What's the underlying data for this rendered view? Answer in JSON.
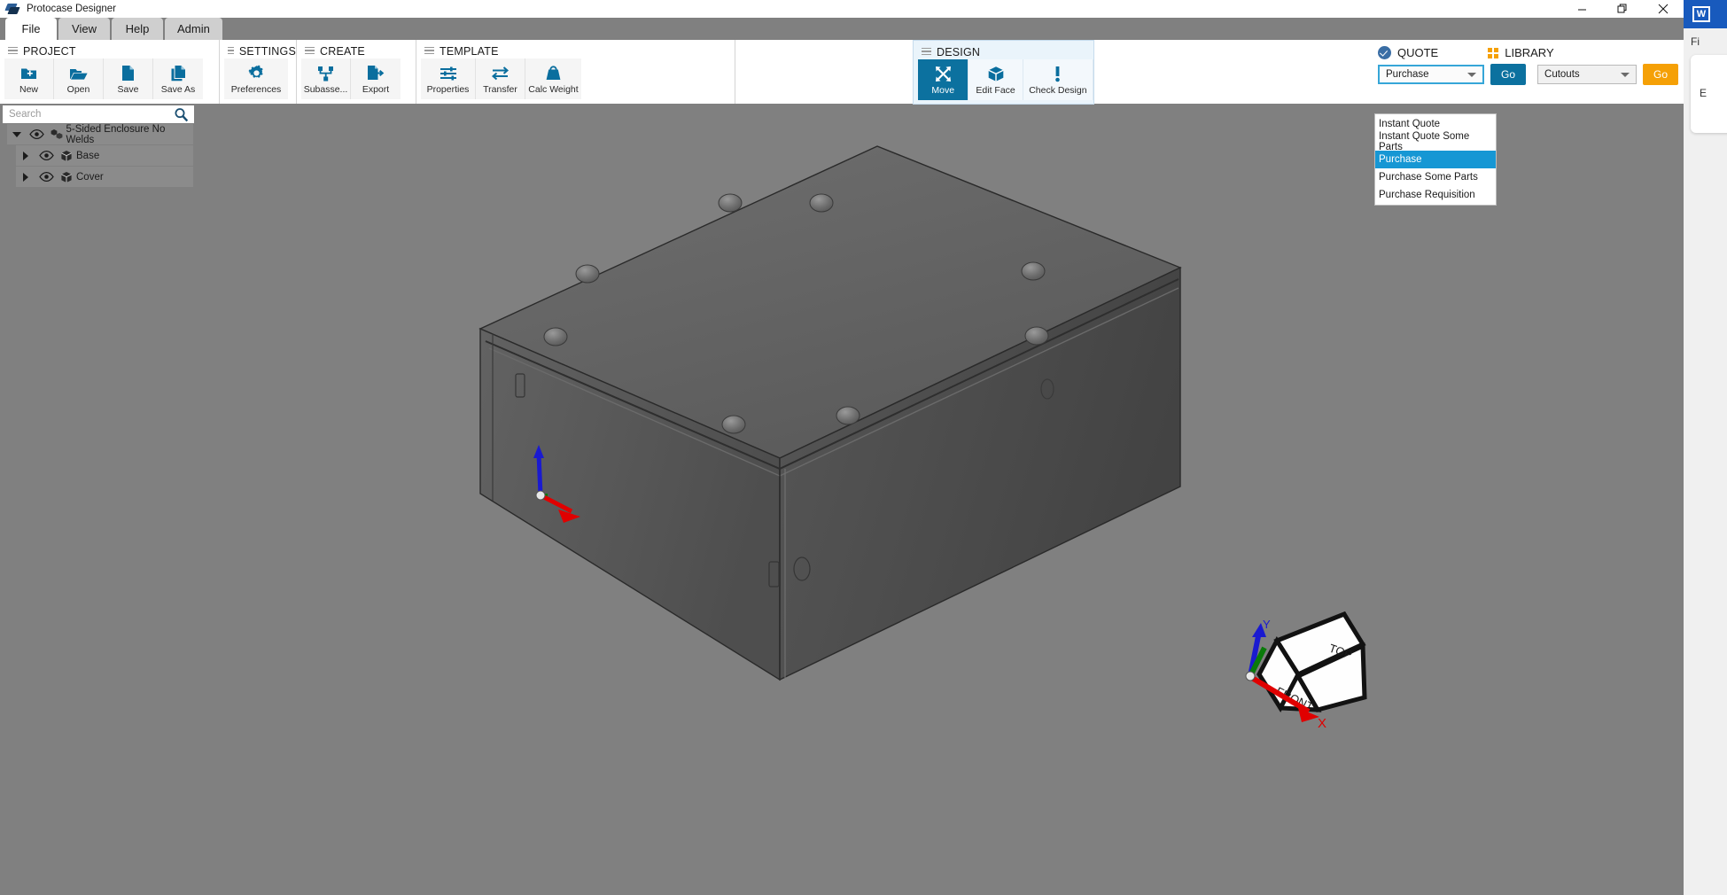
{
  "window": {
    "title": "Protocase Designer",
    "logo_icon": "protocase-logo-icon",
    "minimize_label": "Minimize",
    "restore_label": "Restore",
    "close_label": "Close"
  },
  "tabs": [
    {
      "label": "File",
      "active": true
    },
    {
      "label": "View",
      "active": false
    },
    {
      "label": "Help",
      "active": false
    },
    {
      "label": "Admin",
      "active": false
    }
  ],
  "ribbon": {
    "groups": [
      {
        "title": "PROJECT",
        "buttons": [
          {
            "label": "New",
            "icon": "new-folder-icon"
          },
          {
            "label": "Open",
            "icon": "open-folder-icon"
          },
          {
            "label": "Save",
            "icon": "file-icon"
          },
          {
            "label": "Save As",
            "icon": "copy-files-icon"
          }
        ]
      },
      {
        "title": "SETTINGS",
        "buttons": [
          {
            "label": "Preferences",
            "icon": "gear-icon"
          }
        ]
      },
      {
        "title": "CREATE",
        "buttons": [
          {
            "label": "Subasse...",
            "icon": "subassembly-icon"
          },
          {
            "label": "Export",
            "icon": "export-icon"
          }
        ]
      },
      {
        "title": "TEMPLATE",
        "buttons": [
          {
            "label": "Properties",
            "icon": "sliders-icon"
          },
          {
            "label": "Transfer",
            "icon": "transfer-arrows-icon"
          },
          {
            "label": "Calc Weight",
            "icon": "weight-icon"
          }
        ]
      },
      {
        "title": "DESIGN",
        "buttons": [
          {
            "label": "Move",
            "icon": "move-arrows-icon",
            "active": true
          },
          {
            "label": "Edit Face",
            "icon": "cube-icon"
          },
          {
            "label": "Check Design",
            "icon": "exclamation-icon"
          }
        ]
      }
    ]
  },
  "quote_panel": {
    "quote": {
      "heading": "QUOTE",
      "heading_icon": "check-circle-icon",
      "selected_value": "Purchase",
      "go_label": "Go",
      "options": [
        "Instant Quote",
        "Instant Quote Some Parts",
        "Purchase",
        "Purchase Some Parts",
        "Purchase Requisition"
      ],
      "highlighted_option": "Purchase"
    },
    "library": {
      "heading": "LIBRARY",
      "heading_icon": "grid-icon",
      "selected_value": "Cutouts",
      "go_label": "Go"
    }
  },
  "sidebar": {
    "search": {
      "placeholder": "Search",
      "value": "",
      "icon": "search-icon"
    },
    "tree": [
      {
        "label": "5-Sided Enclosure No Welds",
        "expanded": true,
        "indent": 0,
        "node_icon": "assembly-icon",
        "visibility_icon": "eye-icon"
      },
      {
        "label": "Base",
        "expanded": false,
        "indent": 1,
        "node_icon": "part-cube-icon",
        "visibility_icon": "eye-icon"
      },
      {
        "label": "Cover",
        "expanded": false,
        "indent": 1,
        "node_icon": "part-cube-icon",
        "visibility_icon": "eye-icon"
      }
    ]
  },
  "viewport": {
    "model_name": "5-Sided Enclosure No Welds",
    "origin_gizmo": {
      "x_axis_color": "#e00000",
      "y_axis_color": "#0a7a0a",
      "z_axis_color": "#1a1ad0"
    },
    "view_cube": {
      "top_label": "TOP",
      "front_label": "FRONT",
      "x_label": "X",
      "y_label": "Y"
    }
  },
  "background_app": {
    "name": "Word",
    "icon": "word-icon",
    "ribbon_tab": "Fi",
    "doc_text": "E"
  },
  "colors": {
    "accent_blue": "#0c719f",
    "accent_orange": "#f5a006",
    "highlight_blue": "#1697d4",
    "chrome_gray": "#808080"
  }
}
